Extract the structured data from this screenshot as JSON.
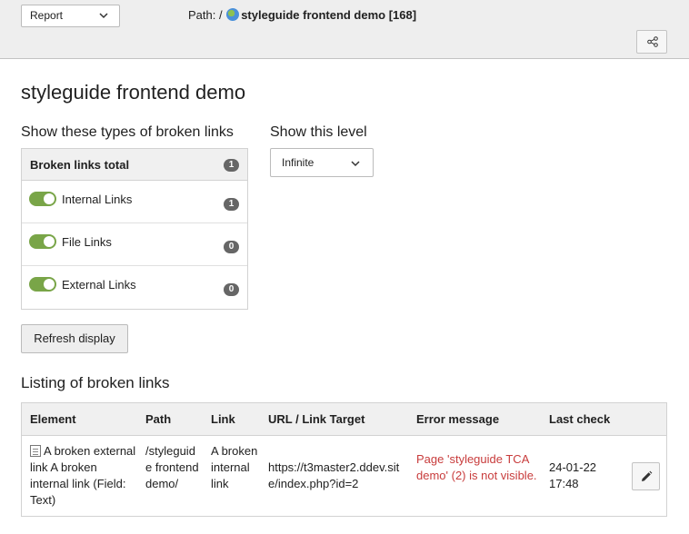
{
  "topbar": {
    "module_select": "Report",
    "path_prefix": "Path: /",
    "path_page": "styleguide frontend demo [168]"
  },
  "page_title": "styleguide frontend demo",
  "filters": {
    "types_label": "Show these types of broken links",
    "level_label": "Show this level",
    "total_label": "Broken links total",
    "total_count": "1",
    "types": [
      {
        "label": "Internal Links",
        "count": "1",
        "enabled": true
      },
      {
        "label": "File Links",
        "count": "0",
        "enabled": true
      },
      {
        "label": "External Links",
        "count": "0",
        "enabled": true
      }
    ],
    "level_value": "Infinite",
    "refresh_label": "Refresh display"
  },
  "listing": {
    "title": "Listing of broken links",
    "columns": [
      "Element",
      "Path",
      "Link",
      "URL / Link Target",
      "Error message",
      "Last check"
    ],
    "rows": [
      {
        "element": "A broken external link A broken internal link (Field: Text)",
        "path": "/styleguide frontend demo/",
        "link": "A broken internal link",
        "url": "https://t3master2.ddev.site/index.php?id=2",
        "error": "Page 'styleguide TCA demo' (2) is not visible.",
        "last_check_date": "24-01-22",
        "last_check_time": "17:48"
      }
    ]
  },
  "colors": {
    "toggle_on": "#79a548",
    "error": "#c83c3c",
    "badge": "#666666"
  }
}
